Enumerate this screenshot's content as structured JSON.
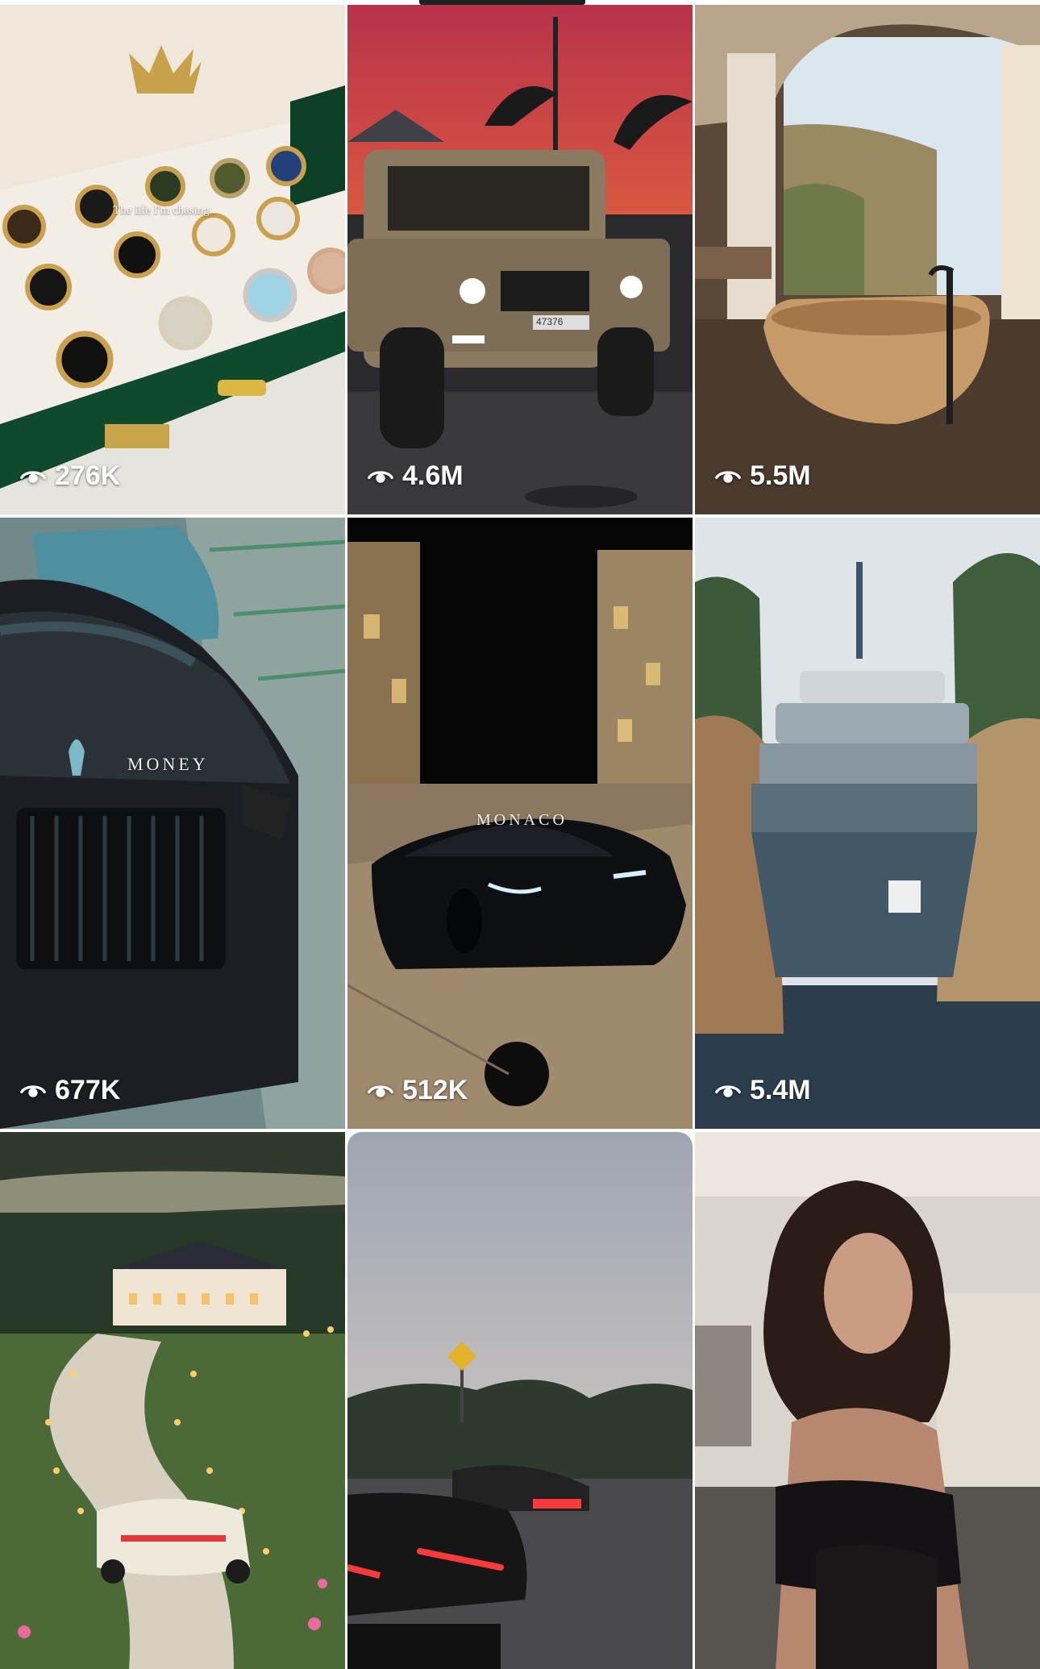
{
  "grid": {
    "items": [
      {
        "subject": "watch-box",
        "views": "276K",
        "caption": "The life I'm chasing.."
      },
      {
        "subject": "suv-sunset",
        "views": "4.6M",
        "plate": "47376"
      },
      {
        "subject": "cliff-bathtub",
        "views": "5.5M"
      },
      {
        "subject": "luxury-sedan",
        "views": "677K",
        "caption": "MONEY"
      },
      {
        "subject": "hypercar-night",
        "views": "512K",
        "caption": "MONACO"
      },
      {
        "subject": "yacht-cove",
        "views": "5.4M"
      },
      {
        "subject": "mansion-drive",
        "views": ""
      },
      {
        "subject": "supercars-road",
        "views": ""
      },
      {
        "subject": "portrait",
        "views": ""
      }
    ]
  },
  "icons": {
    "views": "eye-icon"
  },
  "colors": {
    "view_text": "#ffffff",
    "background": "#ffffff"
  }
}
